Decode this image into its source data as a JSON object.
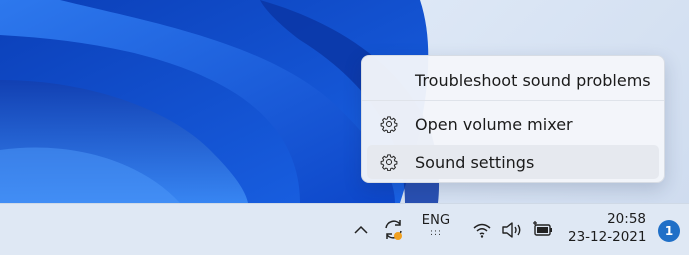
{
  "context_menu": {
    "items": [
      {
        "label": "Troubleshoot sound problems",
        "icon": "none"
      },
      {
        "label": "Open volume mixer",
        "icon": "gear-icon"
      },
      {
        "label": "Sound settings",
        "icon": "gear-icon",
        "highlighted": true
      }
    ]
  },
  "taskbar": {
    "language": {
      "code": "ENG",
      "layout_indicator": ":::"
    },
    "clock": {
      "time": "20:58",
      "date": "23-12-2021"
    },
    "notification_count": "1",
    "tray_icons": [
      "chevron-up-icon",
      "sync-icon",
      "wifi-icon",
      "volume-icon",
      "battery-charging-icon"
    ]
  },
  "colors": {
    "accent": "#1f6fc7",
    "wallpaper_blue": "#1656d8",
    "taskbar_bg": "#dfe8f4",
    "menu_bg": "#f4f6fa",
    "sync_dot": "#f0a020"
  }
}
